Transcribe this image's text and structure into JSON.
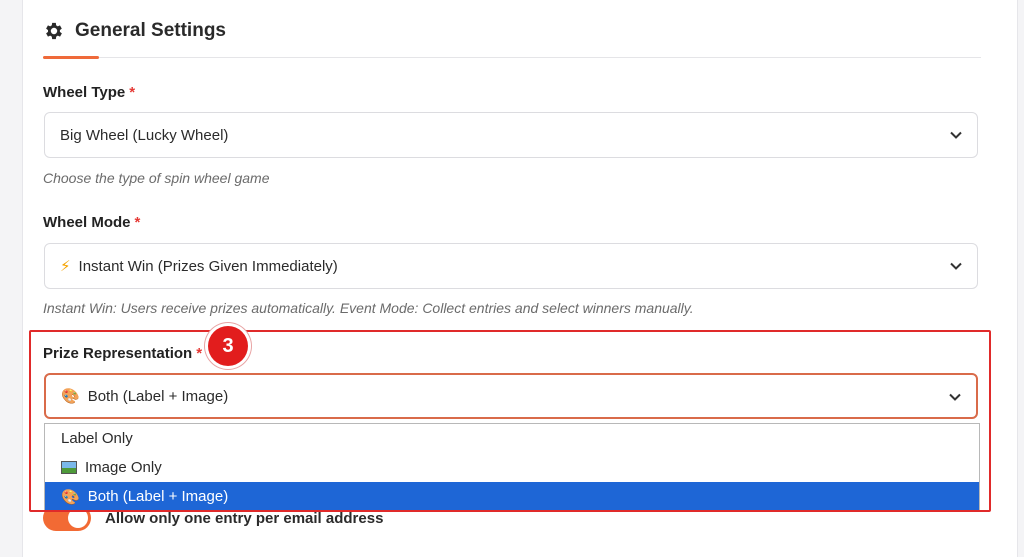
{
  "section": {
    "title": "General Settings",
    "icon": "gear-icon"
  },
  "wheel_type": {
    "label": "Wheel Type",
    "required_mark": "*",
    "value": "Big Wheel (Lucky Wheel)",
    "help": "Choose the type of spin wheel game"
  },
  "wheel_mode": {
    "label": "Wheel Mode",
    "required_mark": "*",
    "icon": "lightning-icon",
    "emoji": "⚡",
    "value": "Instant Win (Prizes Given Immediately)",
    "help": "Instant Win: Users receive prizes automatically. Event Mode: Collect entries and select winners manually."
  },
  "prize_representation": {
    "label": "Prize Representation",
    "required_mark": "*",
    "step_badge": "3",
    "emoji": "🎨",
    "value": "Both (Label + Image)",
    "options": [
      {
        "label": "Label Only",
        "selected": false
      },
      {
        "label": "Image Only",
        "icon": "picture-icon",
        "selected": false
      },
      {
        "label": "Both (Label + Image)",
        "emoji": "🎨",
        "selected": true
      }
    ]
  },
  "toggle": {
    "label": "Allow only one entry per email address",
    "on": true
  },
  "colors": {
    "accent": "#f26a34",
    "highlight": "#e02a2a",
    "selection": "#1e66d6"
  }
}
